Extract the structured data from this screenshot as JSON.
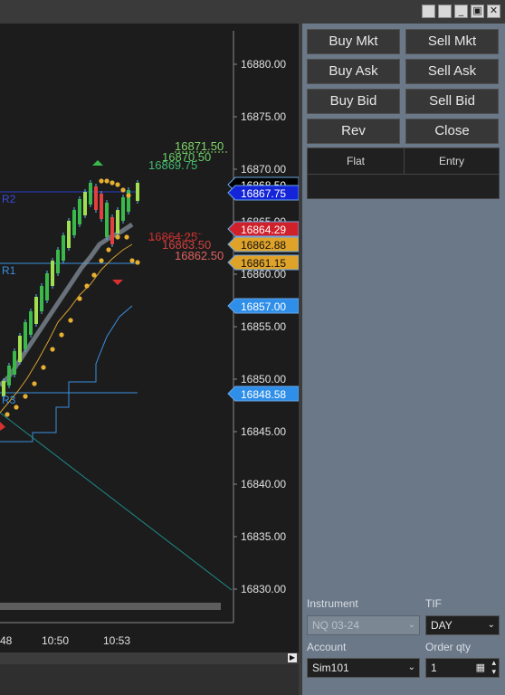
{
  "window": {
    "buttons": [
      "restore-left",
      "restore-right",
      "minimize",
      "maximize",
      "close"
    ]
  },
  "chart": {
    "price_axis": [
      "16880.00",
      "16875.00",
      "16870.00",
      "16865.00",
      "16860.00",
      "16855.00",
      "16850.00",
      "16845.00",
      "16840.00",
      "16835.00",
      "16830.00"
    ],
    "time_axis": [
      "48",
      "10:50",
      "10:53"
    ],
    "pivot_labels": {
      "r1": "R1",
      "r3": "R3",
      "s_top": "R2"
    },
    "annotations": {
      "green_1": "16871.50",
      "green_2": "16870.50",
      "green_3": "16869.75",
      "red_1": "16864.25",
      "red_2": "16863.50",
      "red_3": "16862.50"
    },
    "price_tags": [
      {
        "value": "16868.50",
        "bg": "#000000",
        "fg": "#ffffff"
      },
      {
        "value": "16867.75",
        "bg": "#1424d8",
        "fg": "#ffffff"
      },
      {
        "value": "16864.29",
        "bg": "#d0202a",
        "fg": "#ffffff"
      },
      {
        "value": "16862.88",
        "bg": "#e0a32a",
        "fg": "#111111"
      },
      {
        "value": "16861.15",
        "bg": "#e0a32a",
        "fg": "#111111"
      },
      {
        "value": "16857.00",
        "bg": "#2e8ee8",
        "fg": "#ffffff"
      },
      {
        "value": "16848.58",
        "bg": "#2e8ee8",
        "fg": "#ffffff"
      }
    ]
  },
  "order_panel": {
    "buttons": {
      "buy_mkt": "Buy Mkt",
      "sell_mkt": "Sell Mkt",
      "buy_ask": "Buy Ask",
      "sell_ask": "Sell Ask",
      "buy_bid": "Buy Bid",
      "sell_bid": "Sell Bid",
      "rev": "Rev",
      "close": "Close"
    },
    "position_grid": {
      "col1": "Flat",
      "col2": "Entry"
    },
    "instrument_label": "Instrument",
    "instrument_value": "NQ 03-24",
    "tif_label": "TIF",
    "tif_value": "DAY",
    "account_label": "Account",
    "account_value": "Sim101",
    "order_qty_label": "Order qty",
    "order_qty_value": "1"
  }
}
